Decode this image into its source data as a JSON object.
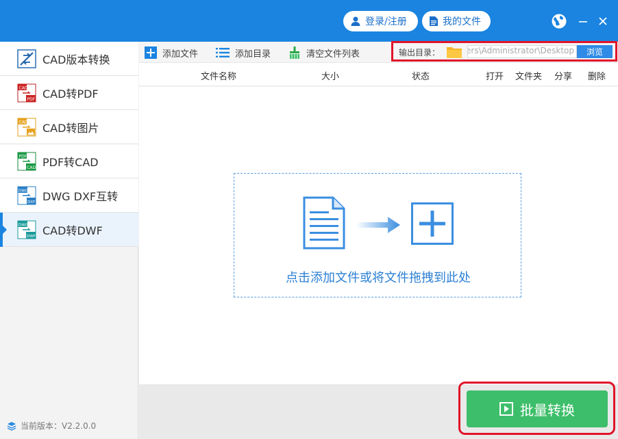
{
  "header": {
    "login_label": "登录/注册",
    "files_label": "我的文件"
  },
  "sidebar": {
    "items": [
      {
        "label": "CAD版本转换",
        "icon": "cad-version-icon"
      },
      {
        "label": "CAD转PDF",
        "icon": "cad-to-pdf-icon"
      },
      {
        "label": "CAD转图片",
        "icon": "cad-to-image-icon"
      },
      {
        "label": "PDF转CAD",
        "icon": "pdf-to-cad-icon"
      },
      {
        "label": "DWG DXF互转",
        "icon": "dwg-dxf-icon"
      },
      {
        "label": "CAD转DWF",
        "icon": "cad-to-dwf-icon"
      }
    ],
    "active_index": 5,
    "version_text": "当前版本：V2.2.0.0"
  },
  "toolbar": {
    "add_file": "添加文件",
    "add_dir": "添加目录",
    "clear_list": "清空文件列表"
  },
  "output": {
    "label": "输出目录：",
    "path": "C:\\Users\\Administrator\\Desktop",
    "browse": "浏览"
  },
  "table": {
    "columns": [
      "文件名称",
      "大小",
      "状态",
      "打开",
      "文件夹",
      "分享",
      "删除"
    ]
  },
  "dropzone": {
    "hint": "点击添加文件或将文件拖拽到此处"
  },
  "convert": {
    "label": "批量转换"
  },
  "colors": {
    "brand": "#1a84e0",
    "accent_green": "#3dbe6a",
    "highlight_red": "#e0142a"
  }
}
